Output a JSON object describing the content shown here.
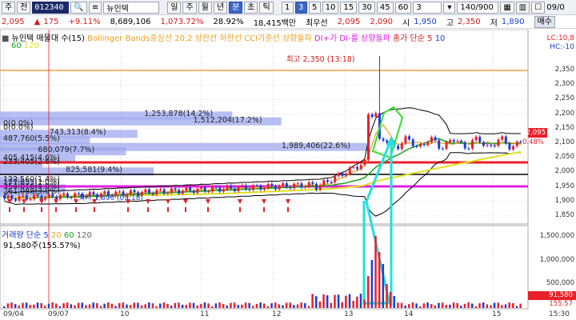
{
  "toolbar": {
    "type_btn": "주",
    "prev_btn": "전",
    "code": "012340",
    "name": "뉴인텍",
    "period_btns": [
      "일",
      "주",
      "월",
      "년",
      "분",
      "초",
      "틱"
    ],
    "minutes": [
      "1",
      "3",
      "5",
      "10",
      "15",
      "30",
      "45",
      "60"
    ],
    "interval": "3",
    "count": "140/900",
    "date_right": "09/0"
  },
  "quote": {
    "price": "2,095",
    "arrow": "▲",
    "change": "175",
    "rate": "+9.11%",
    "volume": "8,689,106",
    "vol_rate": "1,073.72%",
    "turnover": "28.92%",
    "amount": "18,415백만",
    "best": "최우선",
    "bid": "2,095",
    "ask": "2,090",
    "open_label": "시",
    "open": "1,950",
    "high_label": "고",
    "high": "2,350",
    "low_label": "저",
    "low": "1,890",
    "buy_btn": "매수"
  },
  "price_legend": {
    "name": "뉴인텍 매물대 수(15)",
    "bb": "Bollinger Bands중심선 20,2 상한선 하한선",
    "cci": "CCI기준선 상향돌파",
    "di": "DI+가 DI-를 상향돌파",
    "ma": "종가 단순 5",
    "ma2": "10",
    "ma3": "60",
    "ma4": "120",
    "lc": "LC:10,8",
    "hc": "HC:-10"
  },
  "annotations": {
    "high": "최고 2,350 (13:18)",
    "low": "최저 1,890 (09:18)"
  },
  "volume_profile": [
    "1,253,878(14.2%)",
    "1,512,204(17.2%)",
    "0(0.0%)",
    "0(0.0%)",
    "743,313(8.4%)",
    "487,760(5.5%)",
    "1,989,406(22.6%)",
    "680,079(7.7%)",
    "405,415(4.6%)",
    "233,405(2.6%)",
    "825,581(9.4%)",
    "122,560(1.4%)",
    "177,853(2.0%)",
    "354,016(4.0%)",
    "261,088(3.0%)"
  ],
  "price_axis": [
    "2,350",
    "2,300",
    "2,250",
    "2,200",
    "2,150",
    "2,100",
    "2,050",
    "2,000",
    "1,950",
    "1,900",
    "1,850"
  ],
  "price_tags": {
    "current": "2,095",
    "pct": "0.48%",
    "pct2": "2,057"
  },
  "volume_legend": {
    "name": "거래량 단순 5",
    "p20": "20",
    "p60": "60",
    "p120": "120",
    "last": "91,580주(155.57%)"
  },
  "volume_axis": [
    "1,500,000",
    "1,000,000",
    "500,000"
  ],
  "volume_tags": {
    "last": "91,580",
    "pct": "155.57"
  },
  "dates": [
    "09/04",
    "09/07",
    "10",
    "11",
    "12",
    "13",
    "14",
    "15",
    "15:30"
  ],
  "colors": {
    "up": "#e8202a",
    "down": "#1a3fd2",
    "bb": "#000000",
    "ma5": "#e8a020",
    "ma20": "#1aa020",
    "ma60": "#e0e020",
    "ma120": "#e020e0"
  }
}
